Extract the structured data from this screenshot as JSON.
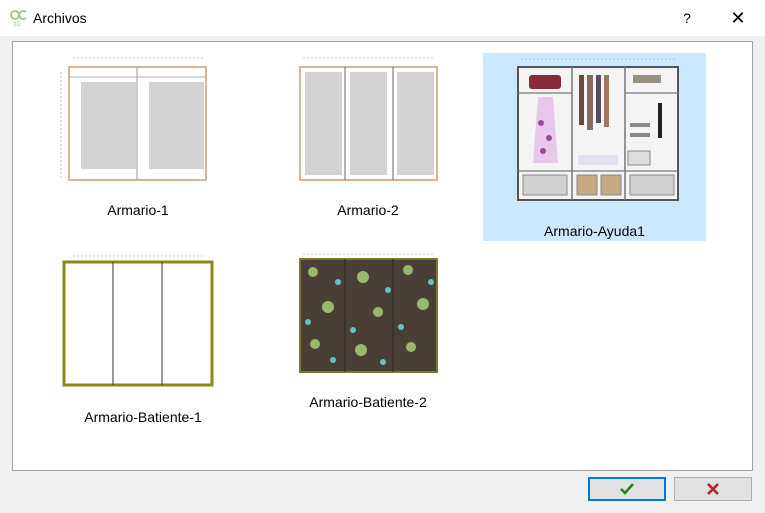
{
  "window": {
    "title": "Archivos",
    "help_label": "?",
    "close_label": "✕"
  },
  "files": [
    {
      "name": "Armario-1",
      "selected": false
    },
    {
      "name": "Armario-2",
      "selected": false
    },
    {
      "name": "Armario-Ayuda1",
      "selected": true
    },
    {
      "name": "Armario-Batiente-1",
      "selected": false
    },
    {
      "name": "Armario-Batiente-2",
      "selected": false
    }
  ],
  "buttons": {
    "ok_icon": "checkmark-icon",
    "cancel_icon": "x-icon"
  },
  "colors": {
    "selection": "#cce8ff",
    "ok_check": "#1a8a1a",
    "cancel_x": "#b22222"
  }
}
